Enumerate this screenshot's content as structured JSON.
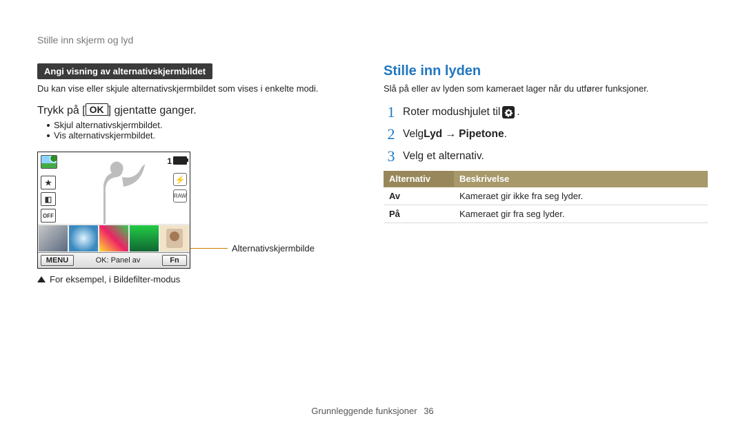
{
  "breadcrumb": "Stille inn skjerm og lyd",
  "left": {
    "badge": "Angi visning av alternativskjermbildet",
    "intro": "Du kan vise eller skjule alternativskjermbildet som vises i enkelte modi.",
    "instr_pre": "Trykk på [",
    "instr_ok": "OK",
    "instr_post": "] gjentatte ganger.",
    "bullet1": "Skjul alternativskjermbildet.",
    "bullet2": "Vis alternativskjermbildet.",
    "screen": {
      "counter": "1",
      "menu": "MENU",
      "mid": "OK: Panel av",
      "fn": "Fn",
      "icon_star": "★",
      "icon_cam": "◧",
      "icon_off": "OFF",
      "right_flash": "⚡",
      "right_raw": "RAW"
    },
    "callout_label": "Alternativskjermbilde",
    "caption": "For eksempel, i Bildefilter-modus"
  },
  "right": {
    "title": "Stille inn lyden",
    "intro": "Slå på eller av lyden som kameraet lager når du utfører funksjoner.",
    "step1": "Roter modushjulet til",
    "step1_end": ".",
    "step2_pre": "Velg ",
    "step2_b1": "Lyd",
    "step2_arrow": "→",
    "step2_b2": "Pipetone",
    "step2_end": ".",
    "step3": "Velg et alternativ.",
    "table": {
      "h1": "Alternativ",
      "h2": "Beskrivelse",
      "r1c1": "Av",
      "r1c2": "Kameraet gir ikke fra seg lyder.",
      "r2c1": "På",
      "r2c2": "Kameraet gir fra seg lyder."
    }
  },
  "footer": {
    "label": "Grunnleggende funksjoner",
    "page": "36"
  }
}
